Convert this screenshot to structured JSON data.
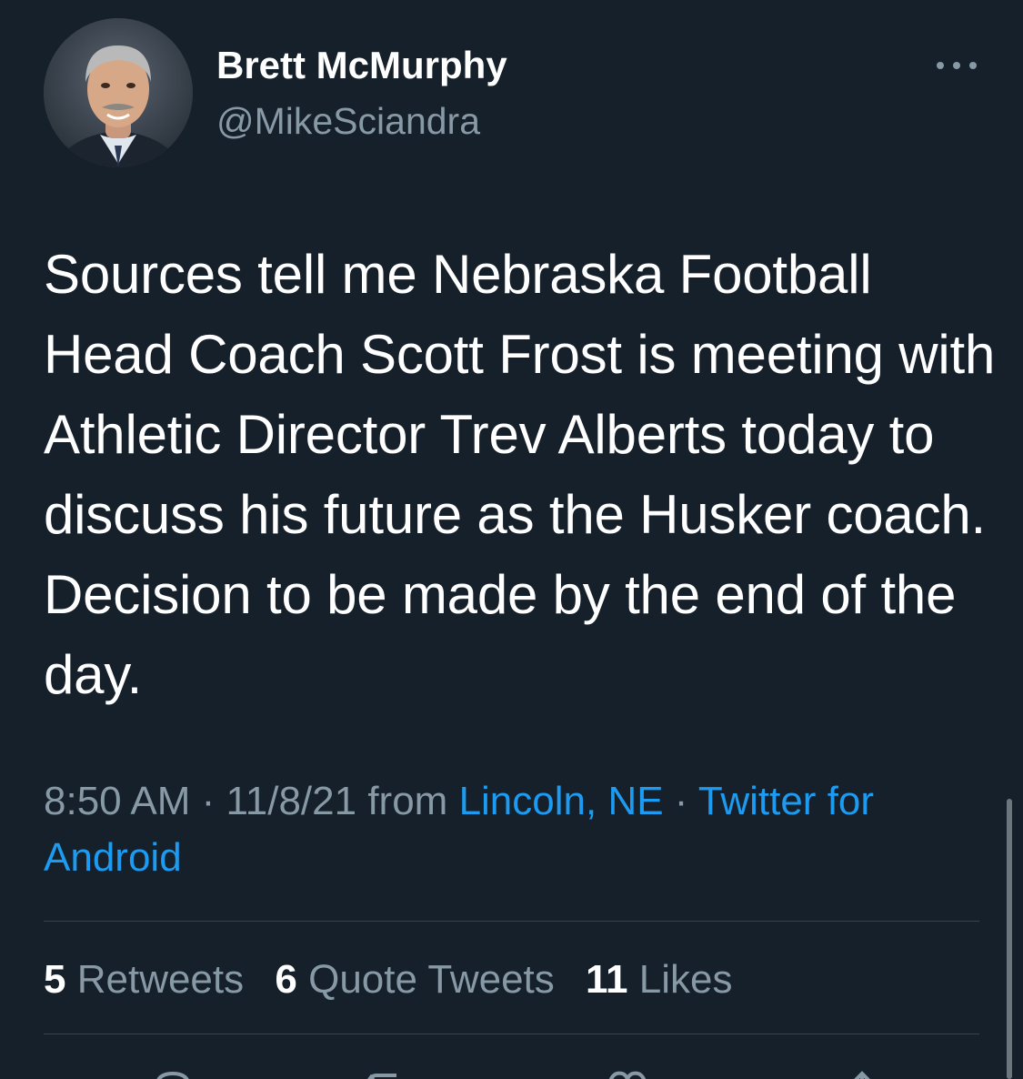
{
  "tweet": {
    "author": {
      "display_name": "Brett McMurphy",
      "handle": "@MikeSciandra"
    },
    "text": "Sources tell me Nebraska Football Head Coach Scott Frost is meeting with Athletic Director Trev Alberts today to discuss his future as the Husker coach. Decision to be made by the end of the day.",
    "meta": {
      "time": "8:50 AM",
      "date": "11/8/21",
      "from_word": "from",
      "location": "Lincoln, NE",
      "source": "Twitter for Android"
    },
    "stats": {
      "retweets": {
        "count": "5",
        "label": "Retweets"
      },
      "quotes": {
        "count": "6",
        "label": "Quote Tweets"
      },
      "likes": {
        "count": "11",
        "label": "Likes"
      }
    }
  },
  "icons": {
    "more": "more-horizontal-icon",
    "reply": "reply-icon",
    "retweet": "retweet-icon",
    "like": "heart-icon",
    "share": "share-icon"
  },
  "colors": {
    "background": "#15202b",
    "text": "#ffffff",
    "secondary": "#8899a6",
    "link": "#1d9bf0",
    "divider": "#38444d"
  }
}
